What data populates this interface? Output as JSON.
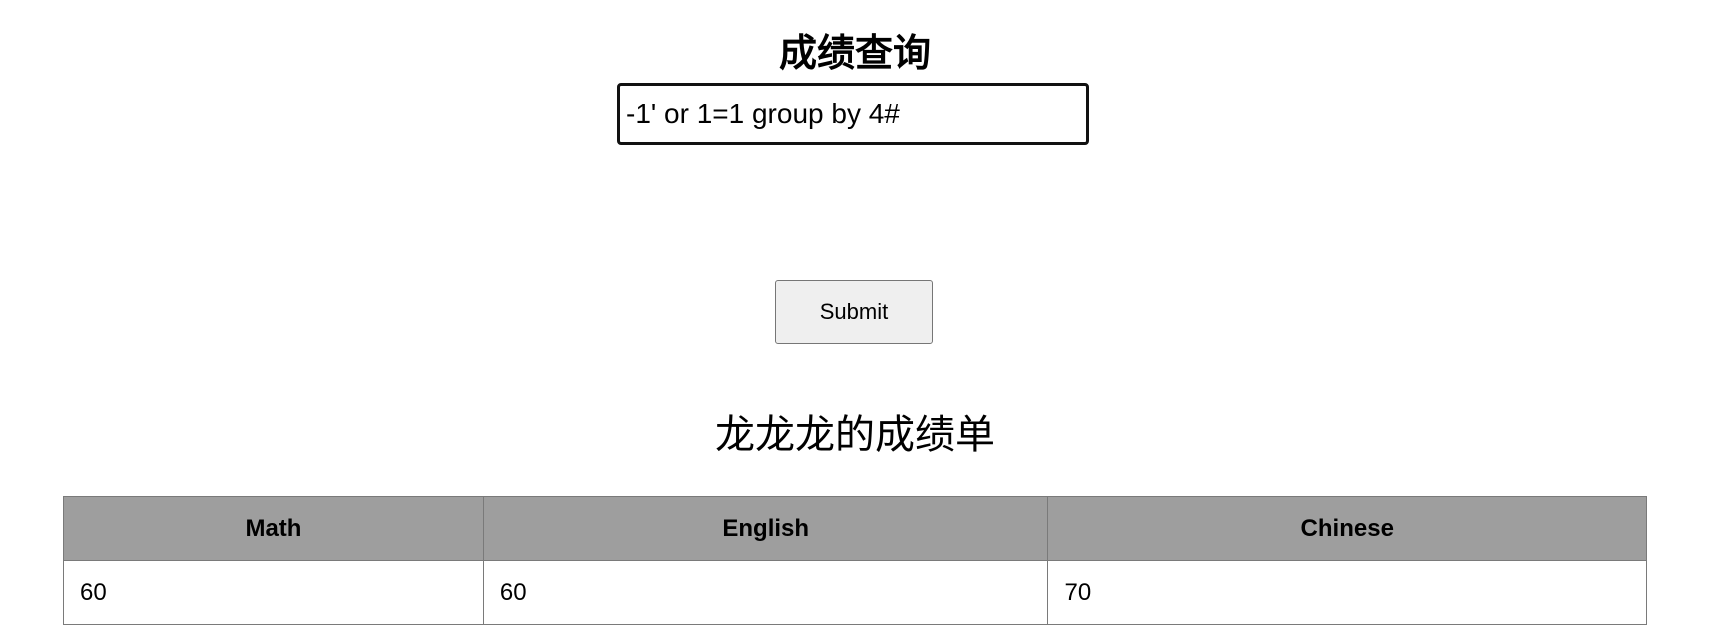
{
  "header": {
    "title": "成绩查询"
  },
  "search": {
    "value": "-1' or 1=1 group by 4#"
  },
  "form": {
    "submit_label": "Submit"
  },
  "results": {
    "title": "龙龙龙的成绩单",
    "columns": [
      "Math",
      "English",
      "Chinese"
    ],
    "rows": [
      [
        "60",
        "60",
        "70"
      ]
    ]
  }
}
